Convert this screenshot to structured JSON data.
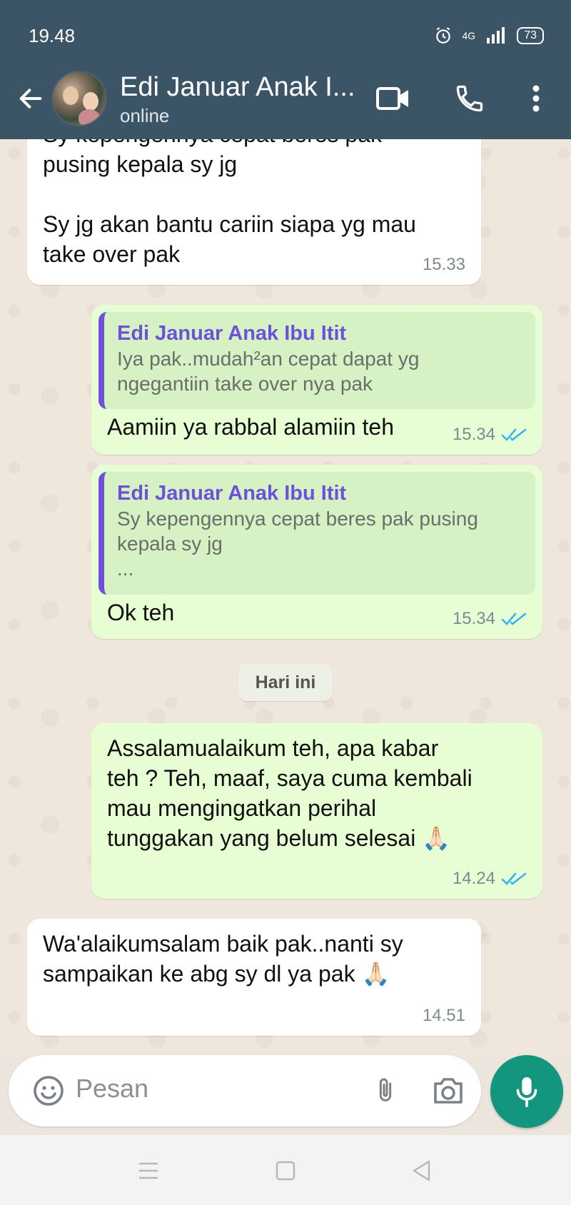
{
  "status_bar": {
    "time": "19.48",
    "network": "4G",
    "battery": "73"
  },
  "header": {
    "contact_name": "Edi Januar Anak I...",
    "contact_status": "online"
  },
  "messages": [
    {
      "direction": "in",
      "text": "Sy kepengennya cepat beres pak\npusing kepala sy jg\n\nSy jg akan bantu cariin  siapa yg mau\ntake over pak",
      "time": "15.33"
    },
    {
      "direction": "out",
      "quote_author": "Edi Januar Anak Ibu Itit",
      "quote_text": "Iya pak..mudah²an cepat dapat yg\nngegantiin take over nya pak",
      "text": "Aamiin ya rabbal alamiin teh",
      "time": "15.34"
    },
    {
      "direction": "out",
      "quote_author": "Edi Januar Anak Ibu Itit",
      "quote_text": "Sy kepengennya cepat beres pak pusing\nkepala sy jg\n...",
      "text": "Ok teh",
      "time": "15.34"
    },
    {
      "direction": "out",
      "text": "Assalamualaikum teh, apa kabar\nteh ? Teh, maaf, saya cuma kembali\nmau mengingatkan perihal\ntunggakan yang belum selesai 🙏🏻",
      "time": "14.24"
    },
    {
      "direction": "in",
      "text": "Wa'alaikumsalam baik pak..nanti sy\nsampaikan ke abg sy dl ya pak 🙏🏻",
      "time": "14.51"
    }
  ],
  "day_divider": "Hari ini",
  "composer": {
    "placeholder": "Pesan"
  },
  "icons": {
    "back": "arrow-left-icon",
    "video": "video-call-icon",
    "call": "phone-icon",
    "menu": "more-vert-icon",
    "emoji": "emoji-icon",
    "attach": "paperclip-icon",
    "camera": "camera-icon",
    "mic": "microphone-icon",
    "read": "double-check-icon"
  },
  "colors": {
    "header": "#3b5466",
    "outgoing": "#e7fdd3",
    "incoming": "#ffffff",
    "quote_accent": "#6b52d9",
    "read_ticks": "#34b7f1",
    "mic_button": "#14957e"
  }
}
